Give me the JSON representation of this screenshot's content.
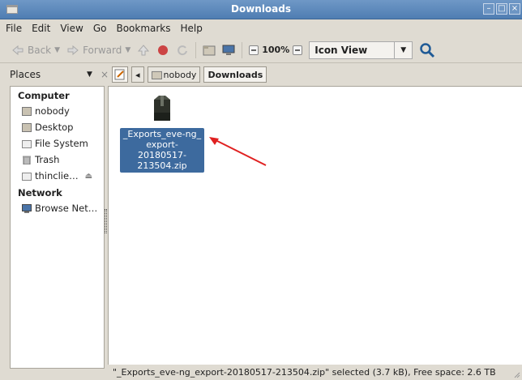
{
  "window": {
    "title": "Downloads"
  },
  "menu": [
    "File",
    "Edit",
    "View",
    "Go",
    "Bookmarks",
    "Help"
  ],
  "toolbar": {
    "back": "Back",
    "forward": "Forward",
    "zoom": "100%",
    "view_mode": "Icon View"
  },
  "places": {
    "header": "Places",
    "close": "×"
  },
  "location": {
    "crumb1": "nobody",
    "crumb2": "Downloads"
  },
  "sidebar": {
    "computer_label": "Computer",
    "computer_items": [
      {
        "label": "nobody",
        "icon": "home-folder-icon"
      },
      {
        "label": "Desktop",
        "icon": "desktop-folder-icon"
      },
      {
        "label": "File System",
        "icon": "drive-icon"
      },
      {
        "label": "Trash",
        "icon": "trash-icon"
      },
      {
        "label": "thinclie…",
        "icon": "drive-icon"
      }
    ],
    "network_label": "Network",
    "network_items": [
      {
        "label": "Browse Net…",
        "icon": "network-icon"
      }
    ]
  },
  "files": [
    {
      "name_lines": [
        "_Exports_eve-ng_",
        "export-20180517-",
        "213504.zip"
      ],
      "icon": "archive-icon",
      "selected": true
    }
  ],
  "status": "\"_Exports_eve-ng_export-20180517-213504.zip\" selected (3.7 kB), Free space: 2.6 TB",
  "colors": {
    "titlebar": "#5a87ba",
    "selection": "#3d6a9e",
    "annotation_arrow": "#e02020"
  }
}
